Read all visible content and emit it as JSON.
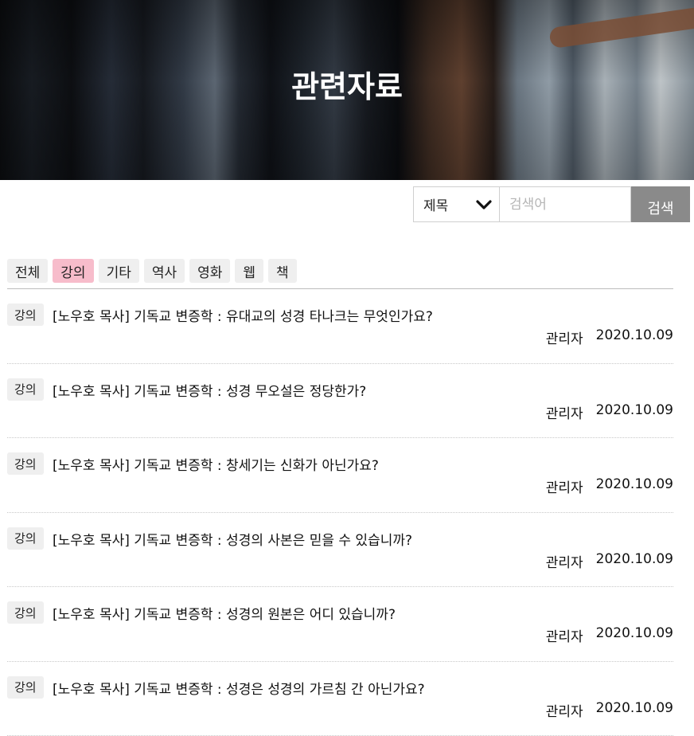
{
  "hero": {
    "title": "관련자료"
  },
  "search": {
    "field_selected": "제목",
    "placeholder": "검색어",
    "button_label": "검색"
  },
  "categories": [
    {
      "label": "전체",
      "active": false
    },
    {
      "label": "강의",
      "active": true
    },
    {
      "label": "기타",
      "active": false
    },
    {
      "label": "역사",
      "active": false
    },
    {
      "label": "영화",
      "active": false
    },
    {
      "label": "웹",
      "active": false
    },
    {
      "label": "책",
      "active": false
    }
  ],
  "posts": [
    {
      "tag": "강의",
      "title": "[노우호 목사] 기독교 변증학 : 유대교의 성경 타나크는 무엇인가요?",
      "author": "관리자",
      "date": "2020.10.09"
    },
    {
      "tag": "강의",
      "title": "[노우호 목사] 기독교 변증학 : 성경 무오설은 정당한가?",
      "author": "관리자",
      "date": "2020.10.09"
    },
    {
      "tag": "강의",
      "title": "[노우호 목사] 기독교 변증학 : 창세기는 신화가 아닌가요?",
      "author": "관리자",
      "date": "2020.10.09"
    },
    {
      "tag": "강의",
      "title": "[노우호 목사] 기독교 변증학 : 성경의 사본은 믿을 수 있습니까?",
      "author": "관리자",
      "date": "2020.10.09"
    },
    {
      "tag": "강의",
      "title": "[노우호 목사] 기독교 변증학 : 성경의 원본은 어디 있습니까?",
      "author": "관리자",
      "date": "2020.10.09"
    },
    {
      "tag": "강의",
      "title": "[노우호 목사] 기독교 변증학 : 성경은 성경의 가르침 간 아닌가요?",
      "author": "관리자",
      "date": "2020.10.09"
    }
  ]
}
